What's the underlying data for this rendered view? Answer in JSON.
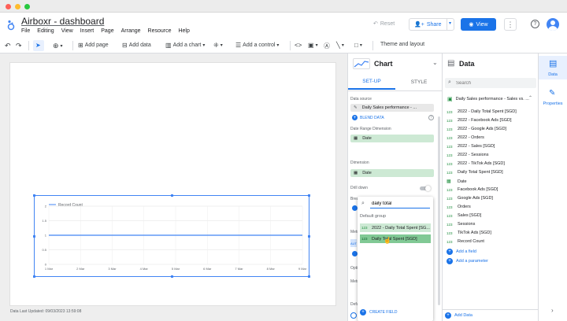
{
  "app": {
    "title": "Airboxr - dashboard",
    "menu": [
      "File",
      "Editing",
      "View",
      "Insert",
      "Page",
      "Arrange",
      "Resource",
      "Help"
    ],
    "reset_label": "Reset",
    "share_label": "Share",
    "view_label": "View",
    "account_initial": ""
  },
  "toolbar": {
    "add_page": "Add page",
    "add_data": "Add data",
    "add_chart": "Add a chart",
    "add_control": "Add a control",
    "theme": "Theme and layout"
  },
  "canvas": {
    "footer": "Data Last Updated: 09/03/2023 13:59:08",
    "chart": {
      "legend": "Record Count"
    }
  },
  "chart_data": {
    "type": "line",
    "x": [
      "1 Mar",
      "2 Mar",
      "3 Mar",
      "4 Mar",
      "5 Mar",
      "6 Mar",
      "7 Mar",
      "8 Mar",
      "9 Mar"
    ],
    "series": [
      {
        "name": "Record Count",
        "values": [
          1,
          1,
          1,
          1,
          1,
          1,
          1,
          1,
          1
        ]
      }
    ],
    "yticks": [
      "0",
      "0.5",
      "1",
      "1.5",
      "2"
    ],
    "ylim": [
      0,
      2
    ],
    "grid": true,
    "legend_position": "top-left",
    "line_color": "#4285f4"
  },
  "chart_panel": {
    "title": "Chart",
    "tab_setup": "SET-UP",
    "tab_style": "STYLE",
    "data_source_label": "Data source",
    "data_source_value": "Daily Sales performance - ...",
    "blend_data": "BLEND DATA",
    "date_range_label": "Date Range Dimension",
    "date_range_value": "Date",
    "dimension_label": "Dimension",
    "dimension_value": "Date",
    "drill_down_label": "Drill down",
    "cut_labels": [
      "Brea",
      "Metr",
      "Opti",
      "Metr",
      "Defa"
    ]
  },
  "dropdown": {
    "search_value": "daily total",
    "group_label": "Default group",
    "options": [
      {
        "tag": "123",
        "label": "2022 - Daily Total Spent [SG..."
      },
      {
        "tag": "123",
        "label": "Daily Total Spent [SGD]"
      }
    ],
    "create_field": "CREATE FIELD"
  },
  "data_panel": {
    "title": "Data",
    "search_placeholder": "Search",
    "source": "Daily Sales performance - Sales vs. ...",
    "fields": [
      {
        "tag": "123",
        "label": "2022 - Daily Total Spent [SGD]"
      },
      {
        "tag": "123",
        "label": "2022 - Facebook Ads [SGD]"
      },
      {
        "tag": "123",
        "label": "2022 - Google Ads [SGD]"
      },
      {
        "tag": "123",
        "label": "2022 - Orders"
      },
      {
        "tag": "123",
        "label": "2022 - Sales [SGD]"
      },
      {
        "tag": "123",
        "label": "2022 - Sessions"
      },
      {
        "tag": "123",
        "label": "2022 - TikTok Ads [SGD]"
      },
      {
        "tag": "123",
        "label": "Daily Total Spent [SGD]"
      },
      {
        "tag": "cal",
        "label": "Date"
      },
      {
        "tag": "123",
        "label": "Facebook Ads [SGD]"
      },
      {
        "tag": "123",
        "label": "Google Ads [SGD]"
      },
      {
        "tag": "123",
        "label": "Orders"
      },
      {
        "tag": "123",
        "label": "Sales [SGD]"
      },
      {
        "tag": "123",
        "label": "Sessions"
      },
      {
        "tag": "123",
        "label": "TikTok Ads [SGD]"
      },
      {
        "tag": "123",
        "label": "Record Count"
      }
    ],
    "add_field": "Add a field",
    "add_parameter": "Add a parameter",
    "add_data": "Add Data"
  },
  "rail": {
    "data_label": "Data",
    "properties_label": "Properties"
  },
  "colors": {
    "accent": "#1a73e8",
    "chip_green": "#cde9d4",
    "field_green": "#1e8e3e"
  }
}
